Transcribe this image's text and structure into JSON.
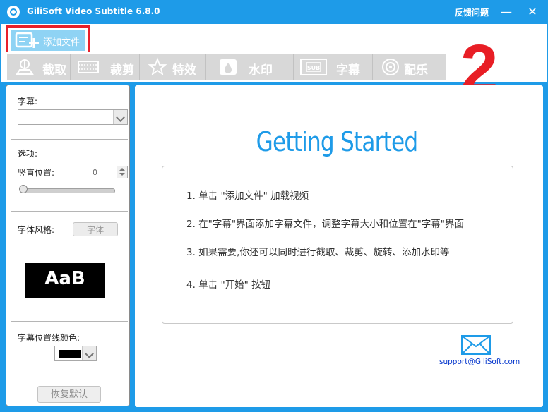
{
  "window": {
    "title": "GiliSoft Video Subtitle 6.8.0",
    "feedback_label": "反馈问题",
    "minimize_glyph": "—",
    "close_glyph": "✕",
    "accent_color": "#1e9be8"
  },
  "toolbar": {
    "add_file_label": "添加文件",
    "add_file_icon": "add-file-icon",
    "highlight_color": "#e8202a",
    "step_number": "2"
  },
  "tabs": [
    {
      "label": "截取",
      "icon": "cut-icon"
    },
    {
      "label": "裁剪",
      "icon": "crop-icon"
    },
    {
      "label": "特效",
      "icon": "effects-icon"
    },
    {
      "label": "水印",
      "icon": "watermark-icon"
    },
    {
      "label": "字幕",
      "icon": "subtitle-icon"
    },
    {
      "label": "配乐",
      "icon": "music-icon"
    }
  ],
  "left_panel": {
    "subtitle_label": "字幕:",
    "subtitle_value": "",
    "options_label": "选项:",
    "vertical_position_label": "竖直位置:",
    "vertical_position_value": "0",
    "font_style_label": "字体风格:",
    "font_button_label": "字体",
    "preview_text": "AaB",
    "line_color_label": "字幕位置线颜色:",
    "line_color_value": "#000000",
    "restore_button_label": "恢复默认"
  },
  "getting_started": {
    "title": "Getting Started",
    "steps": [
      "1. 单击 \"添加文件\" 加载视频",
      "2. 在\"字幕\"界面添加字幕文件，调整字幕大小和位置在\"字幕\"界面",
      "3. 如果需要,你还可以同时进行截取、裁剪、旋转、添加水印等",
      "4. 单击 \"开始\" 按钮"
    ],
    "support_email": "support@GiliSoft.com",
    "mail_icon": "mail-icon"
  }
}
